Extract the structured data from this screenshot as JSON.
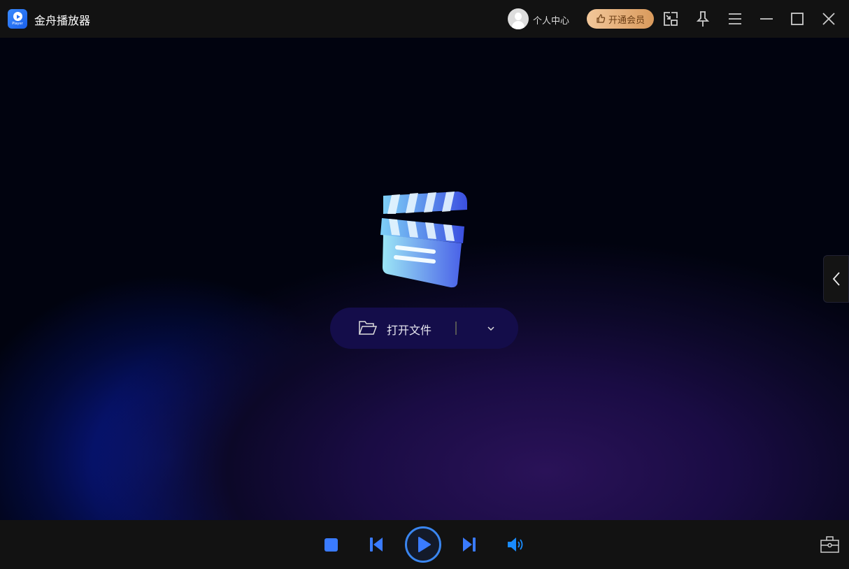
{
  "app": {
    "title": "金舟播放器",
    "logo_text": "Player"
  },
  "header": {
    "user_center": "个人中心",
    "vip_button": "开通会员"
  },
  "main": {
    "open_file": "打开文件"
  },
  "colors": {
    "accent": "#3a7bff",
    "vip": "#e6b07a",
    "button_bg": "#140d4a"
  }
}
